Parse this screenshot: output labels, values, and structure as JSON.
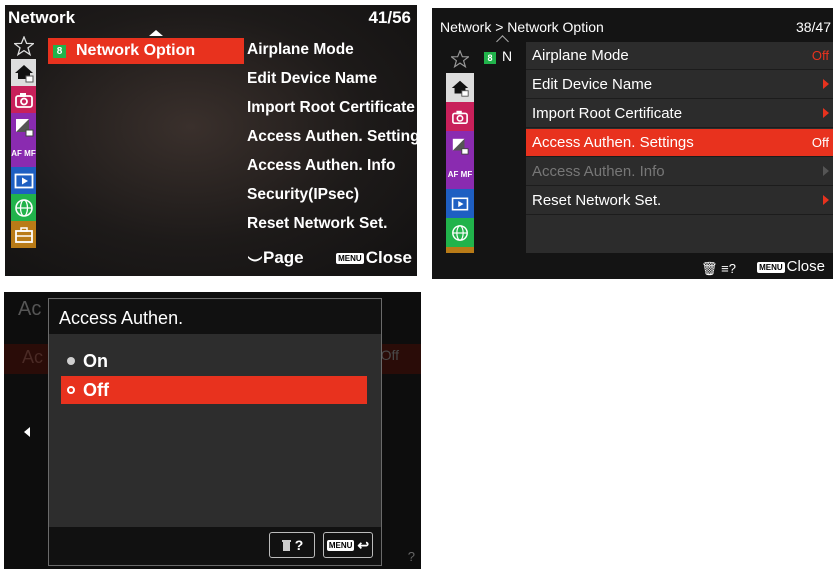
{
  "colors": {
    "accent": "#e8321e",
    "category_badge": "#21b34b"
  },
  "screen1": {
    "title": "Network",
    "page_indicator": "41/56",
    "category": {
      "number": "8",
      "label": "Network Option"
    },
    "items": [
      "Airplane Mode",
      "Edit Device Name",
      "Import Root Certificate",
      "Access Authen. Settings",
      "Access Authen. Info",
      "Security(IPsec)",
      "Reset Network Set."
    ],
    "footer": {
      "page_label": "Page",
      "menu_badge": "MENU",
      "close_label": "Close"
    },
    "tabs": [
      {
        "icon": "star-icon"
      },
      {
        "icon": "home-icon"
      },
      {
        "icon": "camera-icon"
      },
      {
        "icon": "exposure-icon"
      },
      {
        "icon": "af-mf-icon",
        "label": "AF MF"
      },
      {
        "icon": "playback-icon"
      },
      {
        "icon": "globe-icon"
      },
      {
        "icon": "toolbox-icon"
      }
    ]
  },
  "screen2": {
    "breadcrumb": "Network > Network Option",
    "page_indicator": "38/47",
    "category": {
      "number": "8",
      "fragment": "N"
    },
    "rows": [
      {
        "label": "Airplane Mode",
        "value": "Off"
      },
      {
        "label": "Edit Device Name",
        "value": ""
      },
      {
        "label": "Import Root Certificate",
        "value": ""
      },
      {
        "label": "Access Authen. Settings",
        "value": "Off"
      },
      {
        "label": "Access Authen. Info",
        "value": ""
      },
      {
        "label": "Reset Network Set.",
        "value": ""
      }
    ],
    "selected_index": 3,
    "footer": {
      "trash_glyph": "🗑 ≡?",
      "menu_badge": "MENU",
      "close_label": "Close"
    }
  },
  "screen3": {
    "background_title": "Ac",
    "background_row": "Ac",
    "background_value": "Off",
    "background_help": "?",
    "dialog": {
      "title": "Access Authen.",
      "options": [
        {
          "label": "On",
          "selected": false
        },
        {
          "label": "Off",
          "selected": true
        }
      ],
      "help_key": "?",
      "menu_badge": "MENU",
      "back_glyph": "↩"
    }
  }
}
